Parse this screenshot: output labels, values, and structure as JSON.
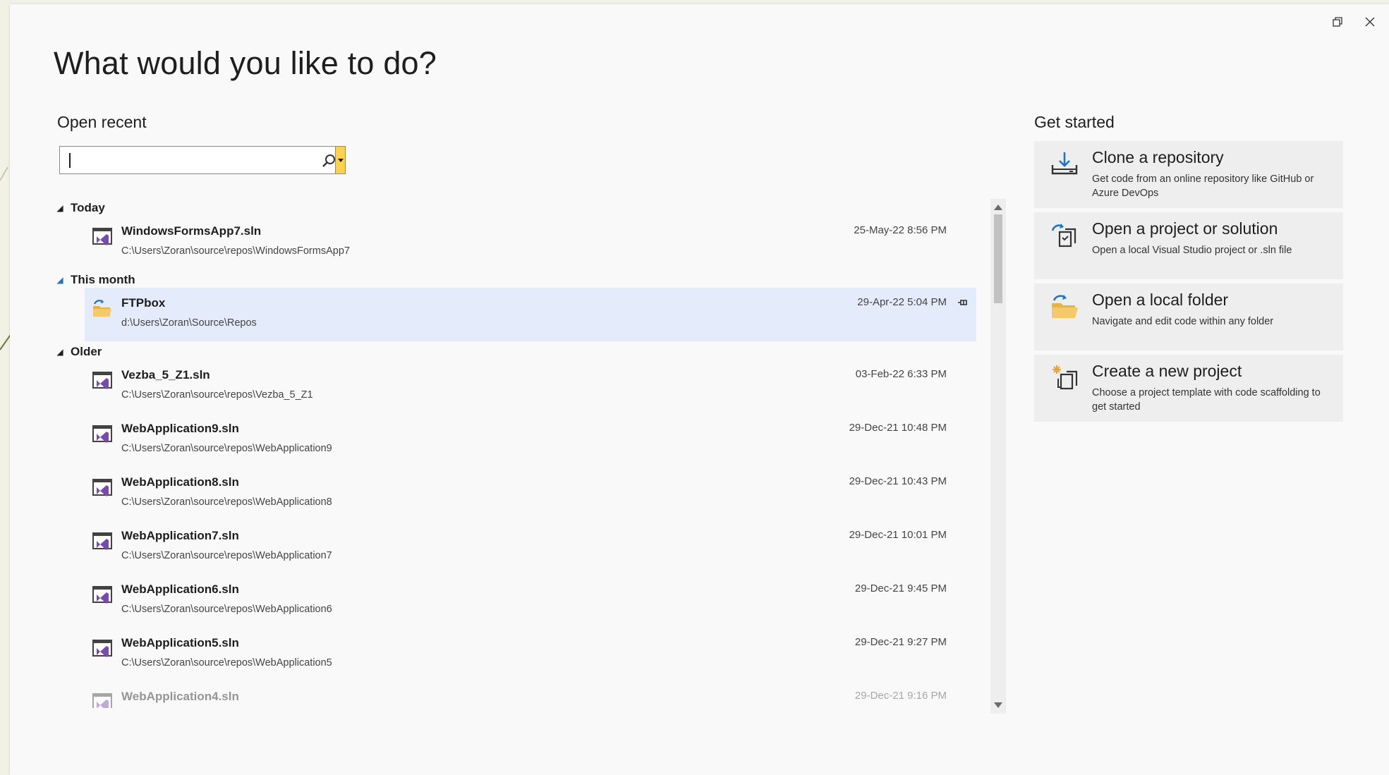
{
  "window": {
    "title": "What would you like to do?",
    "restore_icon": "restore-icon",
    "close_icon": "close-icon"
  },
  "open_recent": {
    "heading": "Open recent",
    "search": {
      "value": "",
      "placeholder": ""
    },
    "groups": [
      {
        "label": "Today",
        "items": [
          {
            "name": "WindowsFormsApp7.sln",
            "path": "C:\\Users\\Zoran\\source\\repos\\WindowsFormsApp7",
            "date": "25-May-22 8:56 PM",
            "icon": "vs-solution-icon"
          }
        ]
      },
      {
        "label": "This month",
        "items": [
          {
            "name": "FTPbox",
            "path": "d:\\Users\\Zoran\\Source\\Repos",
            "date": "29-Apr-22 5:04 PM",
            "icon": "folder-icon",
            "pinned": true,
            "selected": true
          }
        ]
      },
      {
        "label": "Older",
        "items": [
          {
            "name": "Vezba_5_Z1.sln",
            "path": "C:\\Users\\Zoran\\source\\repos\\Vezba_5_Z1",
            "date": "03-Feb-22 6:33 PM",
            "icon": "vs-solution-icon"
          },
          {
            "name": "WebApplication9.sln",
            "path": "C:\\Users\\Zoran\\source\\repos\\WebApplication9",
            "date": "29-Dec-21 10:48 PM",
            "icon": "vs-solution-icon"
          },
          {
            "name": "WebApplication8.sln",
            "path": "C:\\Users\\Zoran\\source\\repos\\WebApplication8",
            "date": "29-Dec-21 10:43 PM",
            "icon": "vs-solution-icon"
          },
          {
            "name": "WebApplication7.sln",
            "path": "C:\\Users\\Zoran\\source\\repos\\WebApplication7",
            "date": "29-Dec-21 10:01 PM",
            "icon": "vs-solution-icon"
          },
          {
            "name": "WebApplication6.sln",
            "path": "C:\\Users\\Zoran\\source\\repos\\WebApplication6",
            "date": "29-Dec-21 9:45 PM",
            "icon": "vs-solution-icon"
          },
          {
            "name": "WebApplication5.sln",
            "path": "C:\\Users\\Zoran\\source\\repos\\WebApplication5",
            "date": "29-Dec-21 9:27 PM",
            "icon": "vs-solution-icon"
          },
          {
            "name": "WebApplication4.sln",
            "path": "",
            "date": "29-Dec-21 9:16 PM",
            "icon": "vs-solution-icon"
          }
        ]
      }
    ]
  },
  "get_started": {
    "heading": "Get started",
    "cards": [
      {
        "title": "Clone a repository",
        "description": "Get code from an online repository like GitHub or Azure DevOps",
        "icon": "clone-download-icon"
      },
      {
        "title": "Open a project or solution",
        "description": "Open a local Visual Studio project or .sln file",
        "icon": "open-project-icon"
      },
      {
        "title": "Open a local folder",
        "description": "Navigate and edit code within any folder",
        "icon": "open-folder-icon"
      },
      {
        "title": "Create a new project",
        "description": "Choose a project template with code scaffolding to get started",
        "icon": "new-project-icon"
      }
    ]
  },
  "colors": {
    "accent": "#1e74c6",
    "vs_purple": "#7a4ab0",
    "selection": "#e4ecfb",
    "folder_yellow": "#e8b24a"
  }
}
